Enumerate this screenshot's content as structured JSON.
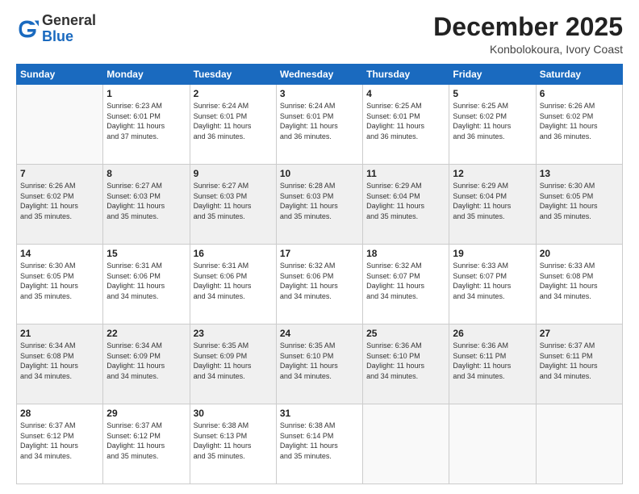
{
  "header": {
    "logo_general": "General",
    "logo_blue": "Blue",
    "month_title": "December 2025",
    "location": "Konbolokoura, Ivory Coast"
  },
  "days_of_week": [
    "Sunday",
    "Monday",
    "Tuesday",
    "Wednesday",
    "Thursday",
    "Friday",
    "Saturday"
  ],
  "weeks": [
    [
      {
        "day": "",
        "info": ""
      },
      {
        "day": "1",
        "info": "Sunrise: 6:23 AM\nSunset: 6:01 PM\nDaylight: 11 hours\nand 37 minutes."
      },
      {
        "day": "2",
        "info": "Sunrise: 6:24 AM\nSunset: 6:01 PM\nDaylight: 11 hours\nand 36 minutes."
      },
      {
        "day": "3",
        "info": "Sunrise: 6:24 AM\nSunset: 6:01 PM\nDaylight: 11 hours\nand 36 minutes."
      },
      {
        "day": "4",
        "info": "Sunrise: 6:25 AM\nSunset: 6:01 PM\nDaylight: 11 hours\nand 36 minutes."
      },
      {
        "day": "5",
        "info": "Sunrise: 6:25 AM\nSunset: 6:02 PM\nDaylight: 11 hours\nand 36 minutes."
      },
      {
        "day": "6",
        "info": "Sunrise: 6:26 AM\nSunset: 6:02 PM\nDaylight: 11 hours\nand 36 minutes."
      }
    ],
    [
      {
        "day": "7",
        "info": "Sunrise: 6:26 AM\nSunset: 6:02 PM\nDaylight: 11 hours\nand 35 minutes."
      },
      {
        "day": "8",
        "info": "Sunrise: 6:27 AM\nSunset: 6:03 PM\nDaylight: 11 hours\nand 35 minutes."
      },
      {
        "day": "9",
        "info": "Sunrise: 6:27 AM\nSunset: 6:03 PM\nDaylight: 11 hours\nand 35 minutes."
      },
      {
        "day": "10",
        "info": "Sunrise: 6:28 AM\nSunset: 6:03 PM\nDaylight: 11 hours\nand 35 minutes."
      },
      {
        "day": "11",
        "info": "Sunrise: 6:29 AM\nSunset: 6:04 PM\nDaylight: 11 hours\nand 35 minutes."
      },
      {
        "day": "12",
        "info": "Sunrise: 6:29 AM\nSunset: 6:04 PM\nDaylight: 11 hours\nand 35 minutes."
      },
      {
        "day": "13",
        "info": "Sunrise: 6:30 AM\nSunset: 6:05 PM\nDaylight: 11 hours\nand 35 minutes."
      }
    ],
    [
      {
        "day": "14",
        "info": "Sunrise: 6:30 AM\nSunset: 6:05 PM\nDaylight: 11 hours\nand 35 minutes."
      },
      {
        "day": "15",
        "info": "Sunrise: 6:31 AM\nSunset: 6:06 PM\nDaylight: 11 hours\nand 34 minutes."
      },
      {
        "day": "16",
        "info": "Sunrise: 6:31 AM\nSunset: 6:06 PM\nDaylight: 11 hours\nand 34 minutes."
      },
      {
        "day": "17",
        "info": "Sunrise: 6:32 AM\nSunset: 6:06 PM\nDaylight: 11 hours\nand 34 minutes."
      },
      {
        "day": "18",
        "info": "Sunrise: 6:32 AM\nSunset: 6:07 PM\nDaylight: 11 hours\nand 34 minutes."
      },
      {
        "day": "19",
        "info": "Sunrise: 6:33 AM\nSunset: 6:07 PM\nDaylight: 11 hours\nand 34 minutes."
      },
      {
        "day": "20",
        "info": "Sunrise: 6:33 AM\nSunset: 6:08 PM\nDaylight: 11 hours\nand 34 minutes."
      }
    ],
    [
      {
        "day": "21",
        "info": "Sunrise: 6:34 AM\nSunset: 6:08 PM\nDaylight: 11 hours\nand 34 minutes."
      },
      {
        "day": "22",
        "info": "Sunrise: 6:34 AM\nSunset: 6:09 PM\nDaylight: 11 hours\nand 34 minutes."
      },
      {
        "day": "23",
        "info": "Sunrise: 6:35 AM\nSunset: 6:09 PM\nDaylight: 11 hours\nand 34 minutes."
      },
      {
        "day": "24",
        "info": "Sunrise: 6:35 AM\nSunset: 6:10 PM\nDaylight: 11 hours\nand 34 minutes."
      },
      {
        "day": "25",
        "info": "Sunrise: 6:36 AM\nSunset: 6:10 PM\nDaylight: 11 hours\nand 34 minutes."
      },
      {
        "day": "26",
        "info": "Sunrise: 6:36 AM\nSunset: 6:11 PM\nDaylight: 11 hours\nand 34 minutes."
      },
      {
        "day": "27",
        "info": "Sunrise: 6:37 AM\nSunset: 6:11 PM\nDaylight: 11 hours\nand 34 minutes."
      }
    ],
    [
      {
        "day": "28",
        "info": "Sunrise: 6:37 AM\nSunset: 6:12 PM\nDaylight: 11 hours\nand 34 minutes."
      },
      {
        "day": "29",
        "info": "Sunrise: 6:37 AM\nSunset: 6:12 PM\nDaylight: 11 hours\nand 35 minutes."
      },
      {
        "day": "30",
        "info": "Sunrise: 6:38 AM\nSunset: 6:13 PM\nDaylight: 11 hours\nand 35 minutes."
      },
      {
        "day": "31",
        "info": "Sunrise: 6:38 AM\nSunset: 6:14 PM\nDaylight: 11 hours\nand 35 minutes."
      },
      {
        "day": "",
        "info": ""
      },
      {
        "day": "",
        "info": ""
      },
      {
        "day": "",
        "info": ""
      }
    ]
  ]
}
